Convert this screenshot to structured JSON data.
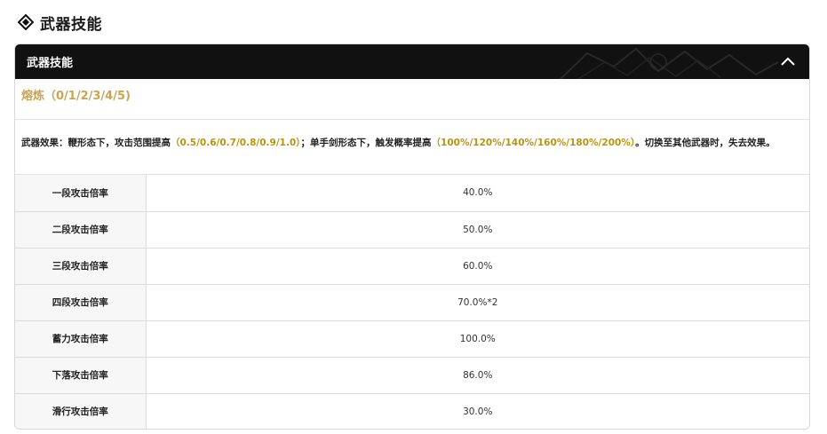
{
  "section": {
    "title": "武器技能",
    "icon": "diamond-icon"
  },
  "card": {
    "header_title": "武器技能",
    "collapse_icon": "chevron-up-icon",
    "refine_label": "熔炼（0/1/2/3/4/5)",
    "effect": {
      "p1": "武器效果：鞭形态下，攻击范围提高",
      "h1": "（0.5/0.6/0.7/0.8/0.9/1.0）",
      "p2": "；单手剑形态下，触发概率提高",
      "h2": "（100%/120%/140%/160%/180%/200%）",
      "p3": "。切换至其他武器时，失去效果。"
    },
    "rows": [
      {
        "label": "一段攻击倍率",
        "value": "40.0%"
      },
      {
        "label": "二段攻击倍率",
        "value": "50.0%"
      },
      {
        "label": "三段攻击倍率",
        "value": "60.0%"
      },
      {
        "label": "四段攻击倍率",
        "value": "70.0%*2"
      },
      {
        "label": "蓄力攻击倍率",
        "value": "100.0%"
      },
      {
        "label": "下落攻击倍率",
        "value": "86.0%"
      },
      {
        "label": "滑行攻击倍率",
        "value": "30.0%"
      }
    ]
  },
  "colors": {
    "header_bg": "#111111",
    "refine_gold": "#c8a455",
    "highlight_gold": "#b8940f"
  }
}
